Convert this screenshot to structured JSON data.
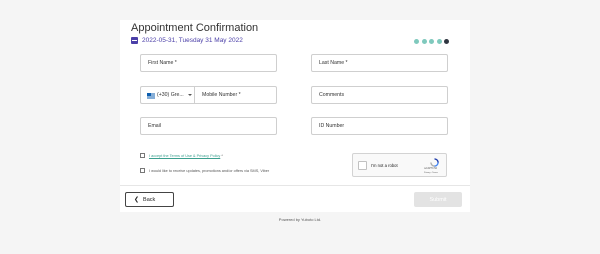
{
  "header": {
    "title": "Appointment Confirmation",
    "date": "2022-05-31, Tuesday 31 May 2022",
    "date_icon": "calendar-icon",
    "steps_total": 5,
    "step_active": 5
  },
  "form": {
    "first_name": "First Name *",
    "last_name": "Last Name *",
    "country_code": "(+30) Gre...",
    "country_flag": "greece-flag-icon",
    "mobile": "Mobile Number *",
    "comments": "Comments",
    "email": "Email",
    "id_number": "ID Number",
    "terms_text": "I accept the Terms of Use & Privacy Policy",
    "terms_required": " *",
    "promo_text": "I would like to receive updates, promotions and/or offers via SMS, Viber"
  },
  "recaptcha": {
    "label": "I'm not a robot",
    "brand": "reCAPTCHA",
    "links": "Privacy - Terms"
  },
  "footer": {
    "back_label": "Back",
    "back_icon": "chevron-left-icon",
    "submit_label": "Submit",
    "powered_by": "Powered by Yuboto Ltd."
  },
  "colors": {
    "accent": "#4b3fa8",
    "step_dot": "#7fc9bd",
    "step_dot_active": "#2f3540",
    "link": "#3ca08f"
  }
}
